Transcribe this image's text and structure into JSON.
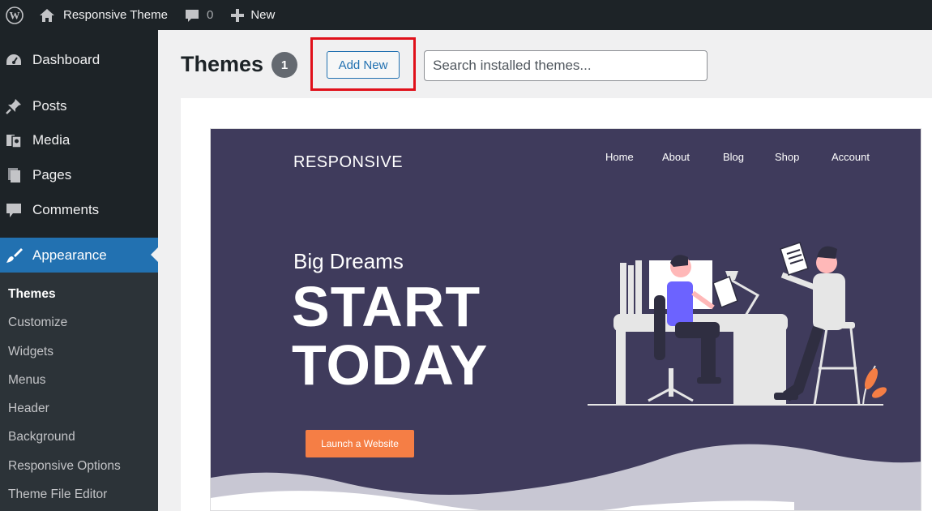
{
  "adminbar": {
    "site_name": "Responsive Theme",
    "comments_count": "0",
    "new_label": "New"
  },
  "sidebar": {
    "items": [
      {
        "label": "Dashboard",
        "icon": "dashboard-icon"
      },
      {
        "label": "Posts",
        "icon": "pin-icon"
      },
      {
        "label": "Media",
        "icon": "media-icon"
      },
      {
        "label": "Pages",
        "icon": "pages-icon"
      },
      {
        "label": "Comments",
        "icon": "comment-icon"
      },
      {
        "label": "Appearance",
        "icon": "paintbrush-icon",
        "active": true
      }
    ],
    "submenu": [
      {
        "label": "Themes",
        "current": true
      },
      {
        "label": "Customize"
      },
      {
        "label": "Widgets"
      },
      {
        "label": "Menus"
      },
      {
        "label": "Header"
      },
      {
        "label": "Background"
      },
      {
        "label": "Responsive Options"
      },
      {
        "label": "Theme File Editor"
      }
    ]
  },
  "header": {
    "title": "Themes",
    "count": "1",
    "add_new_label": "Add New",
    "search_placeholder": "Search installed themes..."
  },
  "theme_preview": {
    "logo": "RESPONSIVE",
    "nav": [
      "Home",
      "About",
      "Blog",
      "Shop",
      "Account"
    ],
    "subtitle": "Big Dreams",
    "headline_line1": "START",
    "headline_line2": "TODAY",
    "cta_label": "Launch a Website"
  },
  "colors": {
    "admin_dark": "#1d2327",
    "accent_blue": "#2271b1",
    "highlight_red": "#e0101a",
    "preview_bg": "#3f3b5c",
    "cta_orange": "#f57e45"
  }
}
